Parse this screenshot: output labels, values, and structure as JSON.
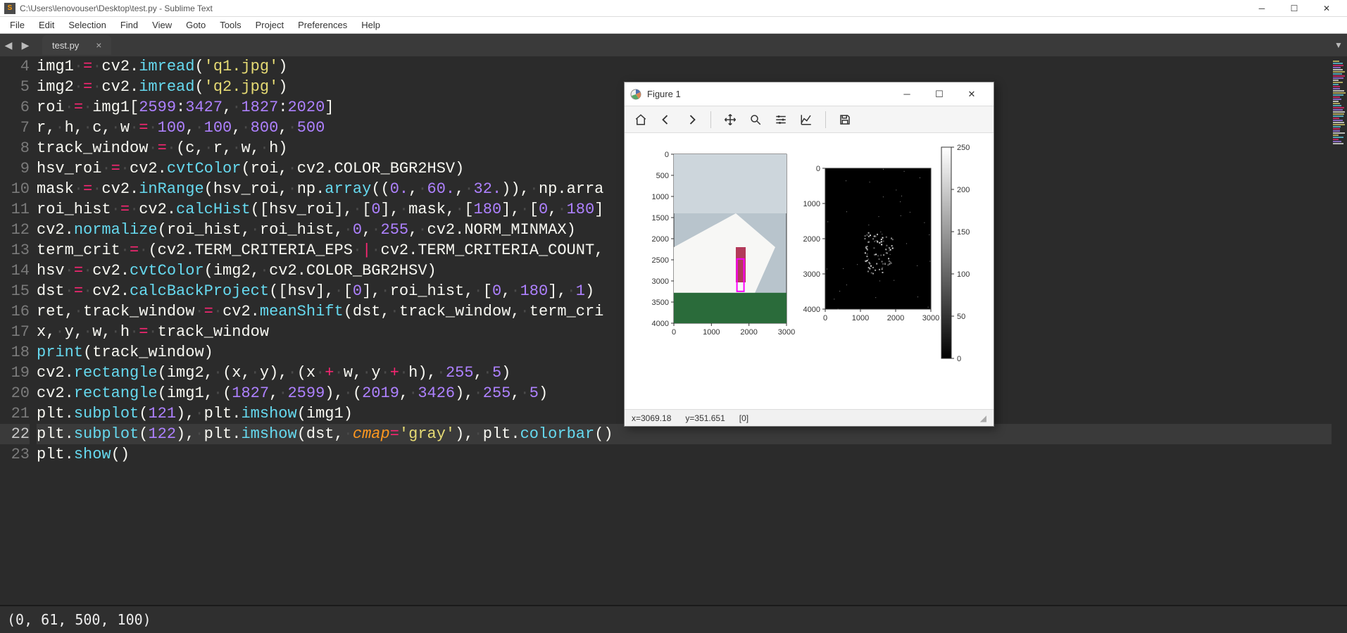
{
  "app": {
    "title": "C:\\Users\\lenovouser\\Desktop\\test.py - Sublime Text",
    "icon_letter": "S"
  },
  "menu": [
    "File",
    "Edit",
    "Selection",
    "Find",
    "View",
    "Goto",
    "Tools",
    "Project",
    "Preferences",
    "Help"
  ],
  "tab": {
    "label": "test.py",
    "dirty": false
  },
  "gutter_start": 4,
  "gutter_end": 23,
  "current_line": 22,
  "code_lines": [
    [
      [
        "id",
        "img1"
      ],
      [
        "ws",
        " "
      ],
      [
        "op",
        "="
      ],
      [
        "ws",
        " "
      ],
      [
        "id",
        "cv2"
      ],
      [
        "pn",
        "."
      ],
      [
        "call",
        "imread"
      ],
      [
        "pn",
        "("
      ],
      [
        "str",
        "'q1.jpg'"
      ],
      [
        "pn",
        ")"
      ]
    ],
    [
      [
        "id",
        "img2"
      ],
      [
        "ws",
        " "
      ],
      [
        "op",
        "="
      ],
      [
        "ws",
        " "
      ],
      [
        "id",
        "cv2"
      ],
      [
        "pn",
        "."
      ],
      [
        "call",
        "imread"
      ],
      [
        "pn",
        "("
      ],
      [
        "str",
        "'q2.jpg'"
      ],
      [
        "pn",
        ")"
      ]
    ],
    [
      [
        "id",
        "roi"
      ],
      [
        "ws",
        " "
      ],
      [
        "op",
        "="
      ],
      [
        "ws",
        " "
      ],
      [
        "id",
        "img1"
      ],
      [
        "pn",
        "["
      ],
      [
        "num",
        "2599"
      ],
      [
        "pn",
        ":"
      ],
      [
        "num",
        "3427"
      ],
      [
        "pn",
        ","
      ],
      [
        "ws",
        " "
      ],
      [
        "num",
        "1827"
      ],
      [
        "pn",
        ":"
      ],
      [
        "num",
        "2020"
      ],
      [
        "pn",
        "]"
      ]
    ],
    [
      [
        "id",
        "r"
      ],
      [
        "pn",
        ","
      ],
      [
        "ws",
        " "
      ],
      [
        "id",
        "h"
      ],
      [
        "pn",
        ","
      ],
      [
        "ws",
        " "
      ],
      [
        "id",
        "c"
      ],
      [
        "pn",
        ","
      ],
      [
        "ws",
        " "
      ],
      [
        "id",
        "w"
      ],
      [
        "ws",
        " "
      ],
      [
        "op",
        "="
      ],
      [
        "ws",
        " "
      ],
      [
        "num",
        "100"
      ],
      [
        "pn",
        ","
      ],
      [
        "ws",
        " "
      ],
      [
        "num",
        "100"
      ],
      [
        "pn",
        ","
      ],
      [
        "ws",
        " "
      ],
      [
        "num",
        "800"
      ],
      [
        "pn",
        ","
      ],
      [
        "ws",
        " "
      ],
      [
        "num",
        "500"
      ]
    ],
    [
      [
        "id",
        "track_window"
      ],
      [
        "ws",
        " "
      ],
      [
        "op",
        "="
      ],
      [
        "ws",
        " "
      ],
      [
        "pn",
        "("
      ],
      [
        "id",
        "c"
      ],
      [
        "pn",
        ","
      ],
      [
        "ws",
        " "
      ],
      [
        "id",
        "r"
      ],
      [
        "pn",
        ","
      ],
      [
        "ws",
        " "
      ],
      [
        "id",
        "w"
      ],
      [
        "pn",
        ","
      ],
      [
        "ws",
        " "
      ],
      [
        "id",
        "h"
      ],
      [
        "pn",
        ")"
      ]
    ],
    [
      [
        "id",
        "hsv_roi"
      ],
      [
        "ws",
        " "
      ],
      [
        "op",
        "="
      ],
      [
        "ws",
        " "
      ],
      [
        "id",
        "cv2"
      ],
      [
        "pn",
        "."
      ],
      [
        "call",
        "cvtColor"
      ],
      [
        "pn",
        "("
      ],
      [
        "id",
        "roi"
      ],
      [
        "pn",
        ","
      ],
      [
        "ws",
        " "
      ],
      [
        "id",
        "cv2"
      ],
      [
        "pn",
        "."
      ],
      [
        "id",
        "COLOR_BGR2HSV"
      ],
      [
        "pn",
        ")"
      ]
    ],
    [
      [
        "id",
        "mask"
      ],
      [
        "ws",
        " "
      ],
      [
        "op",
        "="
      ],
      [
        "ws",
        " "
      ],
      [
        "id",
        "cv2"
      ],
      [
        "pn",
        "."
      ],
      [
        "call",
        "inRange"
      ],
      [
        "pn",
        "("
      ],
      [
        "id",
        "hsv_roi"
      ],
      [
        "pn",
        ","
      ],
      [
        "ws",
        " "
      ],
      [
        "id",
        "np"
      ],
      [
        "pn",
        "."
      ],
      [
        "call",
        "array"
      ],
      [
        "pn",
        "(("
      ],
      [
        "num",
        "0."
      ],
      [
        "pn",
        ","
      ],
      [
        "ws",
        " "
      ],
      [
        "num",
        "60."
      ],
      [
        "pn",
        ","
      ],
      [
        "ws",
        " "
      ],
      [
        "num",
        "32."
      ],
      [
        "pn",
        "))"
      ],
      [
        "pn",
        ","
      ],
      [
        "ws",
        " "
      ],
      [
        "id",
        "np"
      ],
      [
        "pn",
        "."
      ],
      [
        "id",
        "arra"
      ]
    ],
    [
      [
        "id",
        "roi_hist"
      ],
      [
        "ws",
        " "
      ],
      [
        "op",
        "="
      ],
      [
        "ws",
        " "
      ],
      [
        "id",
        "cv2"
      ],
      [
        "pn",
        "."
      ],
      [
        "call",
        "calcHist"
      ],
      [
        "pn",
        "(["
      ],
      [
        "id",
        "hsv_roi"
      ],
      [
        "pn",
        "],"
      ],
      [
        "ws",
        " "
      ],
      [
        "pn",
        "["
      ],
      [
        "num",
        "0"
      ],
      [
        "pn",
        "],"
      ],
      [
        "ws",
        " "
      ],
      [
        "id",
        "mask"
      ],
      [
        "pn",
        ","
      ],
      [
        "ws",
        " "
      ],
      [
        "pn",
        "["
      ],
      [
        "num",
        "180"
      ],
      [
        "pn",
        "],"
      ],
      [
        "ws",
        " "
      ],
      [
        "pn",
        "["
      ],
      [
        "num",
        "0"
      ],
      [
        "pn",
        ","
      ],
      [
        "ws",
        " "
      ],
      [
        "num",
        "180"
      ],
      [
        "pn",
        "]"
      ]
    ],
    [
      [
        "id",
        "cv2"
      ],
      [
        "pn",
        "."
      ],
      [
        "call",
        "normalize"
      ],
      [
        "pn",
        "("
      ],
      [
        "id",
        "roi_hist"
      ],
      [
        "pn",
        ","
      ],
      [
        "ws",
        " "
      ],
      [
        "id",
        "roi_hist"
      ],
      [
        "pn",
        ","
      ],
      [
        "ws",
        " "
      ],
      [
        "num",
        "0"
      ],
      [
        "pn",
        ","
      ],
      [
        "ws",
        " "
      ],
      [
        "num",
        "255"
      ],
      [
        "pn",
        ","
      ],
      [
        "ws",
        " "
      ],
      [
        "id",
        "cv2"
      ],
      [
        "pn",
        "."
      ],
      [
        "id",
        "NORM_MINMAX"
      ],
      [
        "pn",
        ")"
      ]
    ],
    [
      [
        "id",
        "term_crit"
      ],
      [
        "ws",
        " "
      ],
      [
        "op",
        "="
      ],
      [
        "ws",
        " "
      ],
      [
        "pn",
        "("
      ],
      [
        "id",
        "cv2"
      ],
      [
        "pn",
        "."
      ],
      [
        "id",
        "TERM_CRITERIA_EPS"
      ],
      [
        "ws",
        " "
      ],
      [
        "op",
        "|"
      ],
      [
        "ws",
        " "
      ],
      [
        "id",
        "cv2"
      ],
      [
        "pn",
        "."
      ],
      [
        "id",
        "TERM_CRITERIA_COUNT"
      ],
      [
        "pn",
        ","
      ]
    ],
    [
      [
        "id",
        "hsv"
      ],
      [
        "ws",
        " "
      ],
      [
        "op",
        "="
      ],
      [
        "ws",
        " "
      ],
      [
        "id",
        "cv2"
      ],
      [
        "pn",
        "."
      ],
      [
        "call",
        "cvtColor"
      ],
      [
        "pn",
        "("
      ],
      [
        "id",
        "img2"
      ],
      [
        "pn",
        ","
      ],
      [
        "ws",
        " "
      ],
      [
        "id",
        "cv2"
      ],
      [
        "pn",
        "."
      ],
      [
        "id",
        "COLOR_BGR2HSV"
      ],
      [
        "pn",
        ")"
      ]
    ],
    [
      [
        "id",
        "dst"
      ],
      [
        "ws",
        " "
      ],
      [
        "op",
        "="
      ],
      [
        "ws",
        " "
      ],
      [
        "id",
        "cv2"
      ],
      [
        "pn",
        "."
      ],
      [
        "call",
        "calcBackProject"
      ],
      [
        "pn",
        "(["
      ],
      [
        "id",
        "hsv"
      ],
      [
        "pn",
        "],"
      ],
      [
        "ws",
        " "
      ],
      [
        "pn",
        "["
      ],
      [
        "num",
        "0"
      ],
      [
        "pn",
        "],"
      ],
      [
        "ws",
        " "
      ],
      [
        "id",
        "roi_hist"
      ],
      [
        "pn",
        ","
      ],
      [
        "ws",
        " "
      ],
      [
        "pn",
        "["
      ],
      [
        "num",
        "0"
      ],
      [
        "pn",
        ","
      ],
      [
        "ws",
        " "
      ],
      [
        "num",
        "180"
      ],
      [
        "pn",
        "],"
      ],
      [
        "ws",
        " "
      ],
      [
        "num",
        "1"
      ],
      [
        "pn",
        ")"
      ]
    ],
    [
      [
        "id",
        "ret"
      ],
      [
        "pn",
        ","
      ],
      [
        "ws",
        " "
      ],
      [
        "id",
        "track_window"
      ],
      [
        "ws",
        " "
      ],
      [
        "op",
        "="
      ],
      [
        "ws",
        " "
      ],
      [
        "id",
        "cv2"
      ],
      [
        "pn",
        "."
      ],
      [
        "call",
        "meanShift"
      ],
      [
        "pn",
        "("
      ],
      [
        "id",
        "dst"
      ],
      [
        "pn",
        ","
      ],
      [
        "ws",
        " "
      ],
      [
        "id",
        "track_window"
      ],
      [
        "pn",
        ","
      ],
      [
        "ws",
        " "
      ],
      [
        "id",
        "term_cri"
      ]
    ],
    [
      [
        "id",
        "x"
      ],
      [
        "pn",
        ","
      ],
      [
        "ws",
        " "
      ],
      [
        "id",
        "y"
      ],
      [
        "pn",
        ","
      ],
      [
        "ws",
        " "
      ],
      [
        "id",
        "w"
      ],
      [
        "pn",
        ","
      ],
      [
        "ws",
        " "
      ],
      [
        "id",
        "h"
      ],
      [
        "ws",
        " "
      ],
      [
        "op",
        "="
      ],
      [
        "ws",
        " "
      ],
      [
        "id",
        "track_window"
      ]
    ],
    [
      [
        "call",
        "print"
      ],
      [
        "pn",
        "("
      ],
      [
        "id",
        "track_window"
      ],
      [
        "pn",
        ")"
      ]
    ],
    [
      [
        "id",
        "cv2"
      ],
      [
        "pn",
        "."
      ],
      [
        "call",
        "rectangle"
      ],
      [
        "pn",
        "("
      ],
      [
        "id",
        "img2"
      ],
      [
        "pn",
        ","
      ],
      [
        "ws",
        " "
      ],
      [
        "pn",
        "("
      ],
      [
        "id",
        "x"
      ],
      [
        "pn",
        ","
      ],
      [
        "ws",
        " "
      ],
      [
        "id",
        "y"
      ],
      [
        "pn",
        "),"
      ],
      [
        "ws",
        " "
      ],
      [
        "pn",
        "("
      ],
      [
        "id",
        "x"
      ],
      [
        "ws",
        " "
      ],
      [
        "op",
        "+"
      ],
      [
        "ws",
        " "
      ],
      [
        "id",
        "w"
      ],
      [
        "pn",
        ","
      ],
      [
        "ws",
        " "
      ],
      [
        "id",
        "y"
      ],
      [
        "ws",
        " "
      ],
      [
        "op",
        "+"
      ],
      [
        "ws",
        " "
      ],
      [
        "id",
        "h"
      ],
      [
        "pn",
        "),"
      ],
      [
        "ws",
        " "
      ],
      [
        "num",
        "255"
      ],
      [
        "pn",
        ","
      ],
      [
        "ws",
        " "
      ],
      [
        "num",
        "5"
      ],
      [
        "pn",
        ")"
      ]
    ],
    [
      [
        "id",
        "cv2"
      ],
      [
        "pn",
        "."
      ],
      [
        "call",
        "rectangle"
      ],
      [
        "pn",
        "("
      ],
      [
        "id",
        "img1"
      ],
      [
        "pn",
        ","
      ],
      [
        "ws",
        " "
      ],
      [
        "pn",
        "("
      ],
      [
        "num",
        "1827"
      ],
      [
        "pn",
        ","
      ],
      [
        "ws",
        " "
      ],
      [
        "num",
        "2599"
      ],
      [
        "pn",
        "),"
      ],
      [
        "ws",
        " "
      ],
      [
        "pn",
        "("
      ],
      [
        "num",
        "2019"
      ],
      [
        "pn",
        ","
      ],
      [
        "ws",
        " "
      ],
      [
        "num",
        "3426"
      ],
      [
        "pn",
        "),"
      ],
      [
        "ws",
        " "
      ],
      [
        "num",
        "255"
      ],
      [
        "pn",
        ","
      ],
      [
        "ws",
        " "
      ],
      [
        "num",
        "5"
      ],
      [
        "pn",
        ")"
      ]
    ],
    [
      [
        "id",
        "plt"
      ],
      [
        "pn",
        "."
      ],
      [
        "call",
        "subplot"
      ],
      [
        "pn",
        "("
      ],
      [
        "num",
        "121"
      ],
      [
        "pn",
        "),"
      ],
      [
        "ws",
        " "
      ],
      [
        "id",
        "plt"
      ],
      [
        "pn",
        "."
      ],
      [
        "call",
        "imshow"
      ],
      [
        "pn",
        "("
      ],
      [
        "id",
        "img1"
      ],
      [
        "pn",
        ")"
      ]
    ],
    [
      [
        "id",
        "plt"
      ],
      [
        "pn",
        "."
      ],
      [
        "call",
        "subplot"
      ],
      [
        "pn",
        "("
      ],
      [
        "num",
        "122"
      ],
      [
        "pn",
        "),"
      ],
      [
        "ws",
        " "
      ],
      [
        "id",
        "plt"
      ],
      [
        "pn",
        "."
      ],
      [
        "call",
        "imshow"
      ],
      [
        "pn",
        "("
      ],
      [
        "id",
        "dst"
      ],
      [
        "pn",
        ","
      ],
      [
        "ws",
        " "
      ],
      [
        "arg",
        "cmap"
      ],
      [
        "op",
        "="
      ],
      [
        "str",
        "'gray'"
      ],
      [
        "pn",
        "),"
      ],
      [
        "ws",
        " "
      ],
      [
        "id",
        "plt"
      ],
      [
        "pn",
        "."
      ],
      [
        "call",
        "colorbar"
      ],
      [
        "pn",
        "()"
      ]
    ],
    [
      [
        "id",
        "plt"
      ],
      [
        "pn",
        "."
      ],
      [
        "call",
        "show"
      ],
      [
        "pn",
        "()"
      ]
    ]
  ],
  "console": "(0, 61, 500, 100)",
  "figure": {
    "title": "Figure 1",
    "status_x": "x=3069.18",
    "status_y": "y=351.651",
    "status_val": "[0]",
    "left_y_ticks": [
      "0",
      "500",
      "1000",
      "1500",
      "2000",
      "2500",
      "3000",
      "3500",
      "4000"
    ],
    "left_x_ticks": [
      "0",
      "1000",
      "2000",
      "3000"
    ],
    "right_y_ticks": [
      "0",
      "1000",
      "2000",
      "3000",
      "4000"
    ],
    "right_x_ticks": [
      "0",
      "1000",
      "2000",
      "3000"
    ],
    "cbar_ticks": [
      "250",
      "200",
      "150",
      "100",
      "50",
      "0"
    ]
  }
}
